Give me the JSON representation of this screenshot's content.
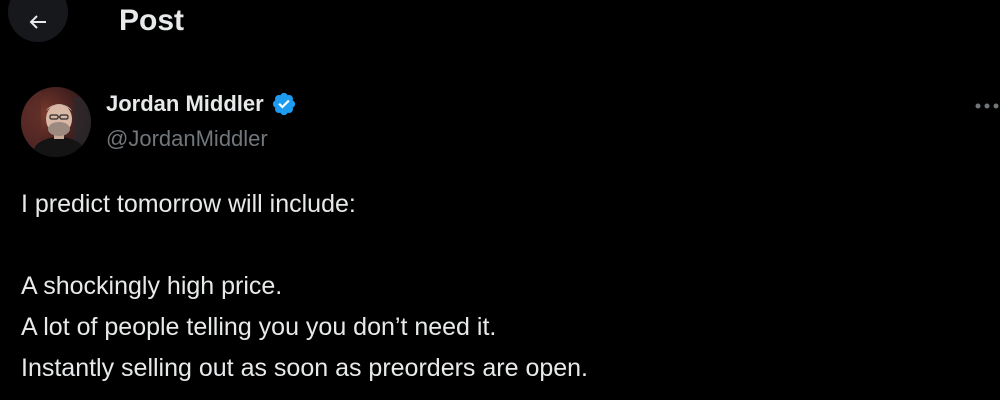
{
  "header": {
    "title": "Post"
  },
  "author": {
    "name": "Jordan Middler",
    "handle": "@JordanMiddler",
    "verified": true
  },
  "post": {
    "lines": [
      "I predict tomorrow will include:",
      "",
      "A shockingly high price.",
      "A lot of people telling you you don’t need it.",
      "Instantly selling out as soon as preorders are open."
    ]
  },
  "icons": {
    "back": "arrow-left-icon",
    "more": "more-horizontal-icon",
    "verified": "verified-badge-icon"
  },
  "colors": {
    "background": "#000000",
    "text": "#e7e9ea",
    "secondary_text": "#71767b",
    "verified_blue": "#1d9bf0",
    "back_button_bg": "#16181c"
  }
}
